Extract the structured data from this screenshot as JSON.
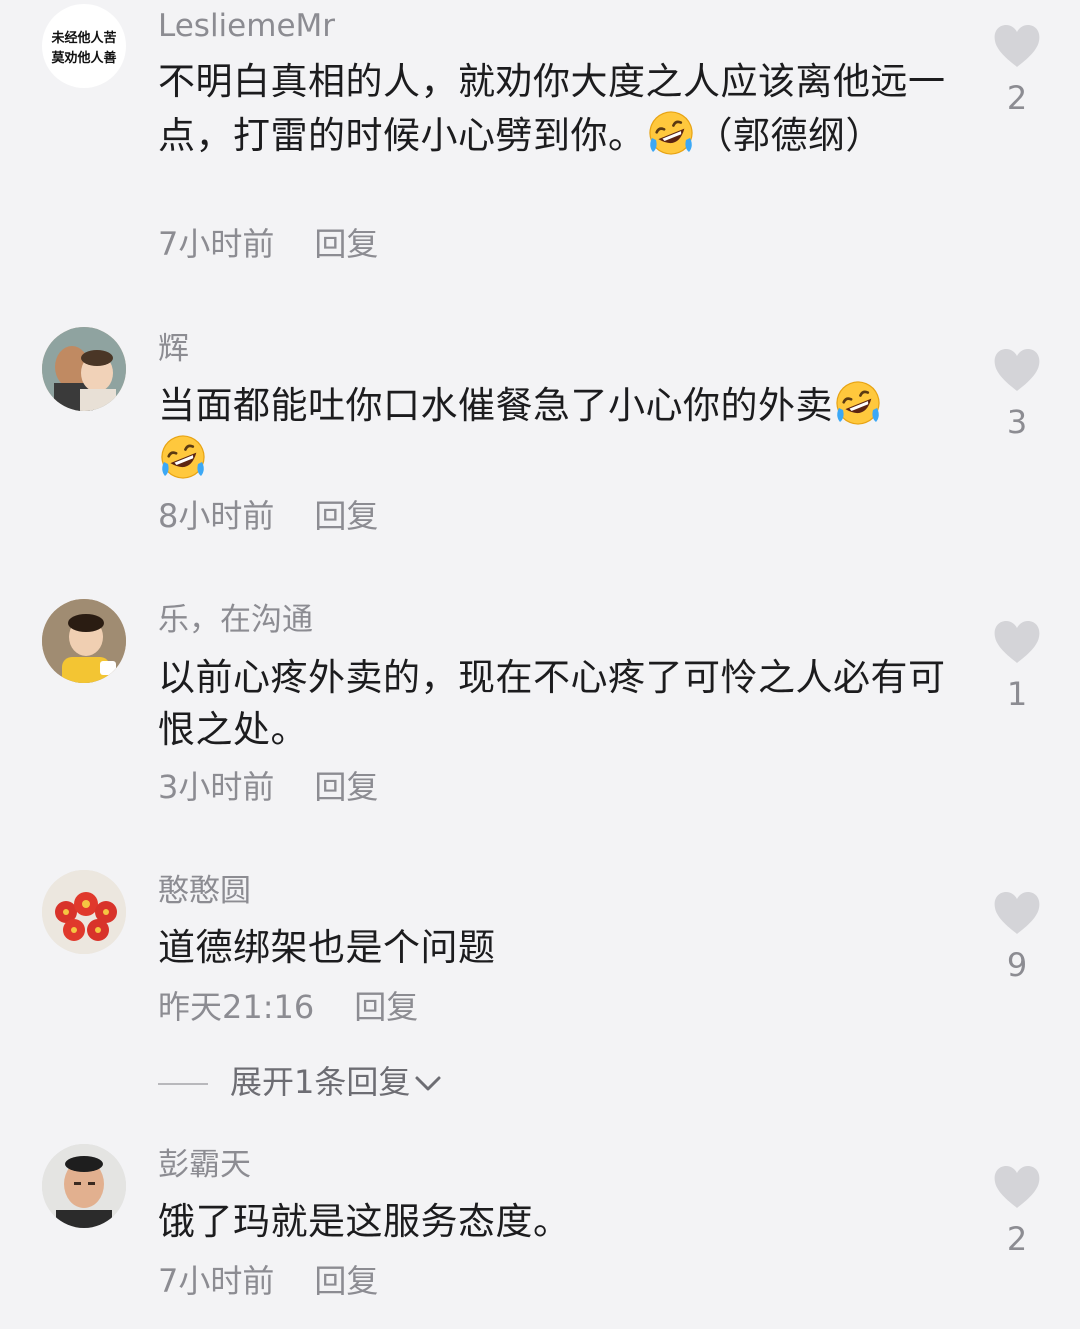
{
  "comments": [
    {
      "username": "LesliemeMr",
      "avatar_text_line1": "未经他人苦",
      "avatar_text_line2": "莫劝他人善",
      "text_part1": "不明白真相的人，就劝你大度之人应该离他远一点，打雷的时候小心劈到你。",
      "text_part2": "（郭德纲）",
      "time": "7小时前",
      "reply_label": "回复",
      "likes": "2"
    },
    {
      "username": "辉",
      "text_part1": "当面都能吐你口水催餐急了小心你的外卖",
      "time": "8小时前",
      "reply_label": "回复",
      "likes": "3"
    },
    {
      "username": "乐，在沟通",
      "text_part1": "以前心疼外卖的，现在不心疼了可怜之人必有可恨之处。",
      "time": "3小时前",
      "reply_label": "回复",
      "likes": "1"
    },
    {
      "username": "憨憨圆",
      "text_part1": "道德绑架也是个问题",
      "time": "昨天21:16",
      "reply_label": "回复",
      "likes": "9",
      "expand_label": "展开1条回复"
    },
    {
      "username": "彭霸天",
      "text_part1": "饿了玛就是这服务态度。",
      "time": "7小时前",
      "reply_label": "回复",
      "likes": "2"
    }
  ],
  "icons": {
    "like": "heart-icon",
    "emoji": "rolling-on-floor-laughing-emoji",
    "expand": "chevron-down-icon"
  },
  "colors": {
    "background": "#f3f3f5",
    "text": "#1c1c1e",
    "secondary": "#8c8c92",
    "heart": "#d4d4d8"
  }
}
